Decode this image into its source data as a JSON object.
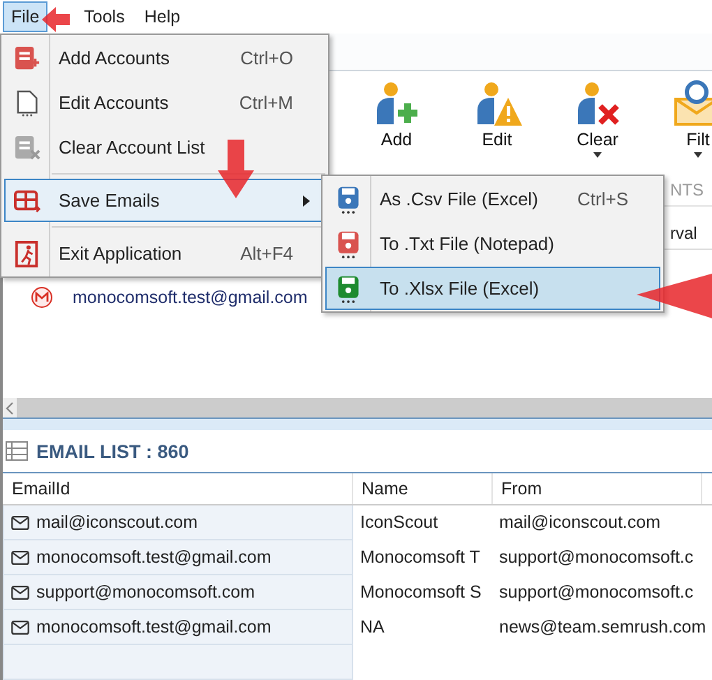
{
  "menubar": [
    {
      "label": "File",
      "selected": true
    },
    {
      "label": "Tools",
      "selected": false
    },
    {
      "label": "Help",
      "selected": false
    }
  ],
  "ribbon": {
    "buttons": [
      {
        "label": "Add",
        "kind": "add",
        "dropdown": false
      },
      {
        "label": "Edit",
        "kind": "edit",
        "dropdown": false
      },
      {
        "label": "Clear",
        "kind": "clear",
        "dropdown": true
      },
      {
        "label": "Filt",
        "kind": "filter",
        "dropdown": true
      }
    ],
    "group_label": "NTS"
  },
  "accounts": {
    "columns": [
      "rval"
    ],
    "rows": [
      {
        "email": "monocomsoft.test@gmail.com"
      }
    ]
  },
  "email_list": {
    "title": "EMAIL LIST : 860",
    "columns": [
      "EmailId",
      "Name",
      "From"
    ],
    "rows": [
      {
        "email": "mail@iconscout.com",
        "name": "IconScout",
        "from": "mail@iconscout.com"
      },
      {
        "email": "monocomsoft.test@gmail.com",
        "name": "Monocomsoft T",
        "from": "support@monocomsoft.c"
      },
      {
        "email": "support@monocomsoft.com",
        "name": "Monocomsoft S",
        "from": "support@monocomsoft.c"
      },
      {
        "email": "monocomsoft.test@gmail.com",
        "name": "NA",
        "from": "news@team.semrush.com"
      }
    ]
  },
  "file_menu": {
    "items": [
      {
        "kind": "item",
        "label": "Add Accounts",
        "shortcut": "Ctrl+O",
        "selected": false
      },
      {
        "kind": "item",
        "label": "Edit Accounts",
        "shortcut": "Ctrl+M",
        "selected": false
      },
      {
        "kind": "item",
        "label": "Clear Account List",
        "selected": false
      },
      {
        "kind": "separator"
      },
      {
        "kind": "submenu",
        "label": "Save Emails",
        "selected": true
      },
      {
        "kind": "separator"
      },
      {
        "kind": "item",
        "label": "Exit Application",
        "shortcut": "Alt+F4",
        "selected": false
      }
    ]
  },
  "save_submenu": {
    "items": [
      {
        "label": "As .Csv File (Excel)",
        "shortcut": "Ctrl+S",
        "selected": false
      },
      {
        "label": "To .Txt File (Notepad)",
        "selected": false
      },
      {
        "label": "To .Xlsx File (Excel)",
        "selected": true
      }
    ]
  }
}
